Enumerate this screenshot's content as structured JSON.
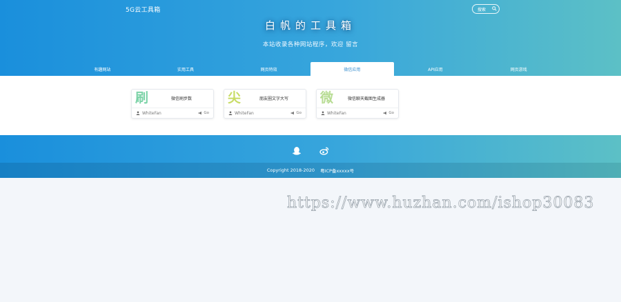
{
  "header": {
    "logo": "5G云工具箱",
    "search_label": "搜索",
    "title": "白帆的工具箱",
    "subtitle": "本站收录各种网站程序，欢迎 留言"
  },
  "tabs": [
    {
      "label": "有趣网站",
      "active": false
    },
    {
      "label": "实用工具",
      "active": false
    },
    {
      "label": "网页特效",
      "active": false
    },
    {
      "label": "微信应用",
      "active": true
    },
    {
      "label": "API应用",
      "active": false
    },
    {
      "label": "网页游戏",
      "active": false
    }
  ],
  "cards": [
    {
      "char": "刷",
      "char_color": "#7dd3a8",
      "title": "微信刷步数",
      "author": "WhiteFan",
      "go": "Go"
    },
    {
      "char": "尖",
      "char_color": "#c8dc66",
      "title": "朋友圈文字大写",
      "author": "WhiteFan",
      "go": "Go"
    },
    {
      "char": "微",
      "char_color": "#b7dc93",
      "title": "微信聊天截图生成器",
      "author": "WhiteFan",
      "go": "Go"
    }
  ],
  "footer": {
    "icons": [
      "qq-icon",
      "weibo-icon"
    ],
    "copyright": "Copyright 2018-2020",
    "icp": "粤ICP备xxxxx号"
  },
  "watermark": "https://www.huzhan.com/ishop30083",
  "colors": {
    "header_start": "#1a8fdc",
    "header_end": "#5cc0c6",
    "active_tab_text": "#3a8fd0"
  }
}
